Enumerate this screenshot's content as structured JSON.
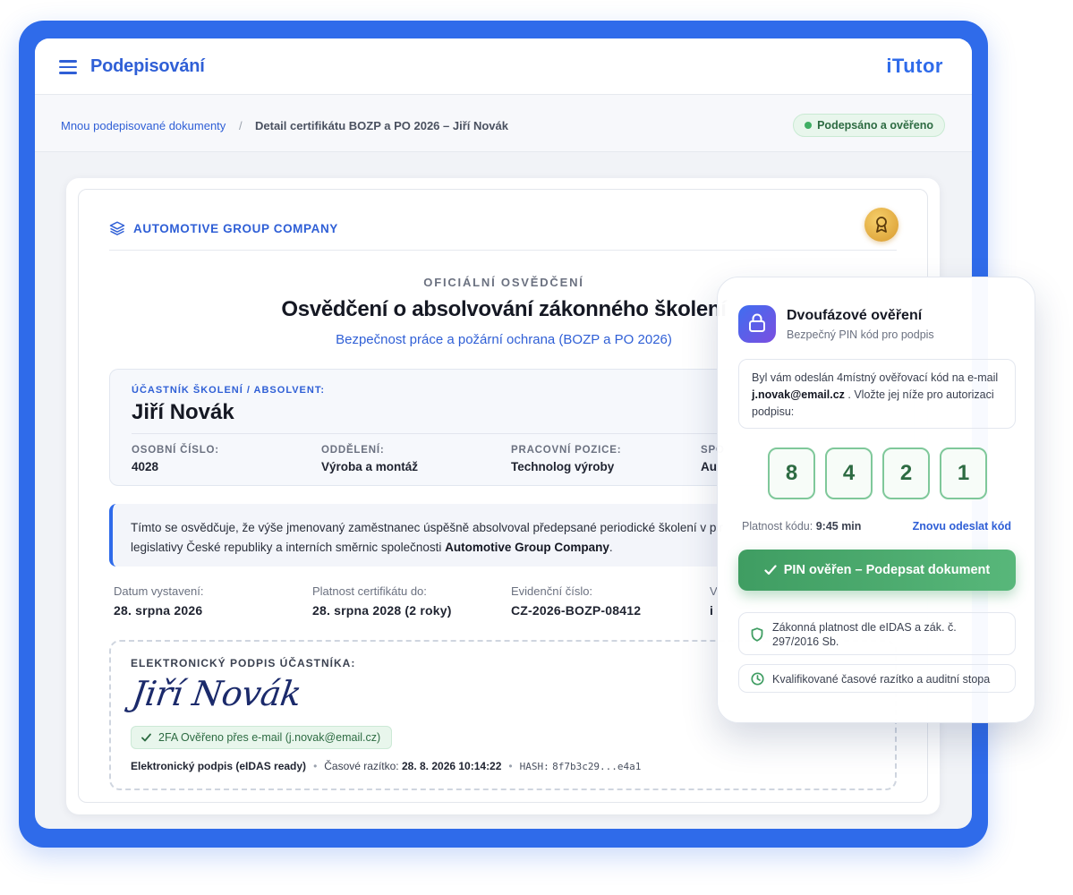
{
  "header": {
    "app_title": "Podepisování",
    "brand": "iTutor"
  },
  "breadcrumb": {
    "parent": "Mnou podepisované dokumenty",
    "separator": "/",
    "current": "Detail certifikátu BOZP a PO 2026 – Jiří Novák"
  },
  "status": {
    "label": "Podepsáno a ověřeno",
    "color": "#3fae63"
  },
  "certificate": {
    "company": "AUTOMOTIVE GROUP COMPANY",
    "eyebrow": "OFICIÁLNÍ OSVĚDČENÍ",
    "title": "Osvědčení o absolvování zákonného školení",
    "subtitle": "Bezpečnost práce a požární ochrana (BOZP a PO 2026)",
    "participant": {
      "label": "ÚČASTNÍK ŠKOLENÍ / ABSOLVENT:",
      "name": "Jiří Novák",
      "fields": [
        {
          "key": "OSOBNÍ ČÍSLO:",
          "value": "4028"
        },
        {
          "key": "ODDĚLENÍ:",
          "value": "Výroba a montáž"
        },
        {
          "key": "PRACOVNÍ POZICE:",
          "value": "Technolog výroby"
        },
        {
          "key": "SPO",
          "value": "Au"
        }
      ]
    },
    "declaration": {
      "text_1": "Tímto se osvědčuje, že výše jmenovaný zaměstnanec úspěšně absolvoval předepsané periodické školení v plr",
      "text_2": "legislativy České republiky a interních směrnic společnosti ",
      "company_bold": "Automotive Group Company",
      "text_end": "."
    },
    "meta": [
      {
        "key": "Datum vystavení:",
        "value": "28. srpna 2026"
      },
      {
        "key": "Platnost certifikátu do:",
        "value": "28. srpna 2028 (2 roky)"
      },
      {
        "key": "Evidenční číslo:",
        "value": "CZ-2026-BOZP-08412"
      },
      {
        "key": "V",
        "value": "i"
      }
    ],
    "signature": {
      "label": "ELEKTRONICKÝ PODPIS ÚČASTNÍKA:",
      "script": "Jiří Novák",
      "verified": "2FA Ověřeno přes e-mail (j.novak@email.cz)",
      "type": "Elektronický podpis (eIDAS ready)",
      "timestamp_label": "Časové razítko:",
      "timestamp": "28. 8. 2026 10:14:22",
      "hash_label": "HASH:",
      "hash": "8f7b3c29...e4a1"
    }
  },
  "two_factor": {
    "title": "Dvoufázové ověření",
    "subtitle": "Bezpečný PIN kód pro podpis",
    "message_1": "Byl vám odeslán 4místný ověřovací kód na e-mail ",
    "email": "j.novak@email.cz",
    "message_2": " . Vložte jej níže pro autorizaci podpisu:",
    "pin": [
      "8",
      "4",
      "2",
      "1"
    ],
    "validity_label": "Platnost kódu: ",
    "validity_value": "9:45 min",
    "resend": "Znovu odeslat kód",
    "confirm": "PIN ověřen – Podepsat dokument",
    "info_legal": "Zákonná platnost dle eIDAS a zák. č. 297/2016 Sb.",
    "info_timestamp": "Kvalifikované časové razítko a auditní stopa"
  },
  "colors": {
    "accent": "#2f6bea",
    "success": "#3f9d62"
  }
}
